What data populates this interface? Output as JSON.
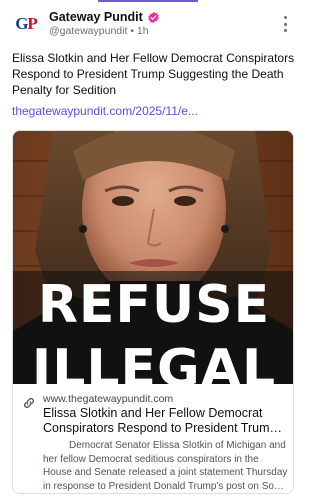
{
  "post": {
    "author": {
      "name": "Gateway Pundit",
      "handle": "@gatewaypundit",
      "separator": "•",
      "time": "1h",
      "avatar_text_g": "G",
      "avatar_text_p": "P"
    },
    "text": "Elissa Slotkin and Her Fellow Democrat Conspirators Respond to President Trump Suggesting the Death Penalty for Sedition",
    "link_text": "thegatewaypundit.com/2025/11/e...",
    "card": {
      "image_text_line1": "REFUSE",
      "image_text_line2": "ILLEGAL",
      "domain": "www.thegatewaypundit.com",
      "title_line1": "Elissa Slotkin and Her Fellow Democrat",
      "title_line2": "Conspirators Respond to President Trump Sugg...",
      "description_lines": [
        "Democrat Senator Elissa Slotkin of Michigan and",
        "her fellow Democrat seditious conspirators in the",
        "House and Senate released a joint statement Thursday",
        "in response to President Donald Trump's post on Soci..."
      ]
    }
  },
  "colors": {
    "link": "#5b4fd8",
    "verified_badge": "#e0349a",
    "accent_bar": "#6b5bd6"
  },
  "icons": [
    "verified-badge-icon",
    "more-options-icon",
    "link-icon"
  ]
}
